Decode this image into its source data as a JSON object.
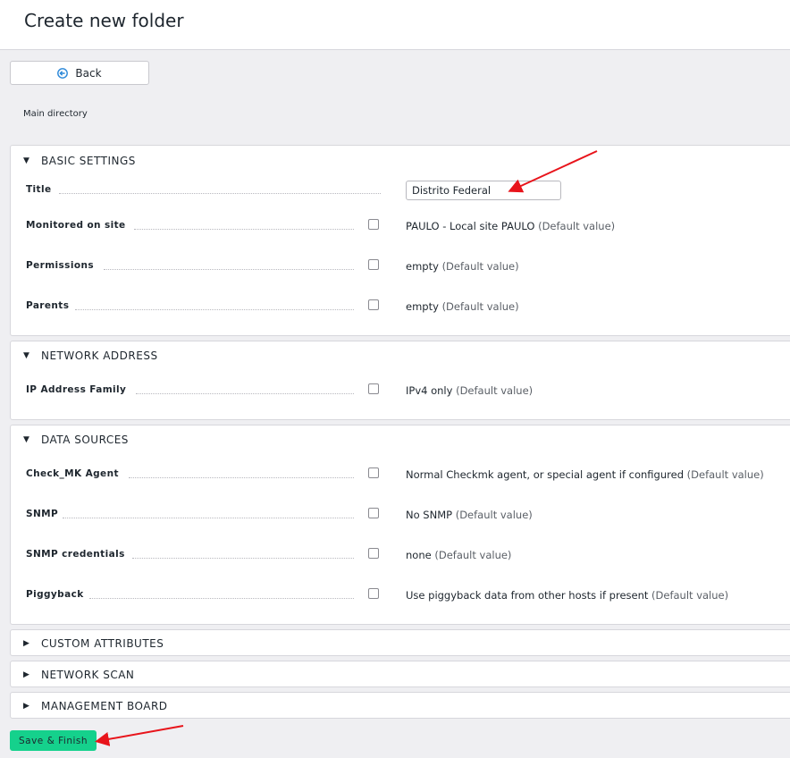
{
  "header": {
    "title": "Create new folder"
  },
  "toolbar": {
    "back_label": "Back"
  },
  "breadcrumb": "Main directory",
  "sections": {
    "basic": {
      "title": "BASIC SETTINGS",
      "title_field": {
        "label": "Title",
        "value": "Distrito Federal"
      },
      "rows": [
        {
          "label": "Monitored on site",
          "value": "PAULO - Local site PAULO",
          "default": "(Default value)"
        },
        {
          "label": "Permissions",
          "value": "empty",
          "default": "(Default value)"
        },
        {
          "label": "Parents",
          "value": "empty",
          "default": "(Default value)"
        }
      ]
    },
    "network": {
      "title": "NETWORK ADDRESS",
      "rows": [
        {
          "label": "IP Address Family",
          "value": "IPv4 only",
          "default": "(Default value)"
        }
      ]
    },
    "data_sources": {
      "title": "DATA SOURCES",
      "rows": [
        {
          "label": "Check_MK Agent",
          "value": "Normal Checkmk agent, or special agent if configured",
          "default": "(Default value)"
        },
        {
          "label": "SNMP",
          "value": "No SNMP",
          "default": "(Default value)"
        },
        {
          "label": "SNMP credentials",
          "value": "none",
          "default": "(Default value)"
        },
        {
          "label": "Piggyback",
          "value": "Use piggyback data from other hosts if present",
          "default": "(Default value)"
        }
      ]
    },
    "custom_attributes": {
      "title": "CUSTOM ATTRIBUTES"
    },
    "network_scan": {
      "title": "NETWORK SCAN"
    },
    "management_board": {
      "title": "MANAGEMENT BOARD"
    }
  },
  "footer": {
    "save_label": "Save & Finish"
  },
  "colors": {
    "accent": "#15d18c",
    "annotation_arrow": "#e8141b",
    "background": "#efeff2"
  },
  "icons": {
    "back": "back-arrow-circle-icon",
    "expanded": "triangle-down-icon",
    "collapsed": "triangle-right-icon"
  }
}
